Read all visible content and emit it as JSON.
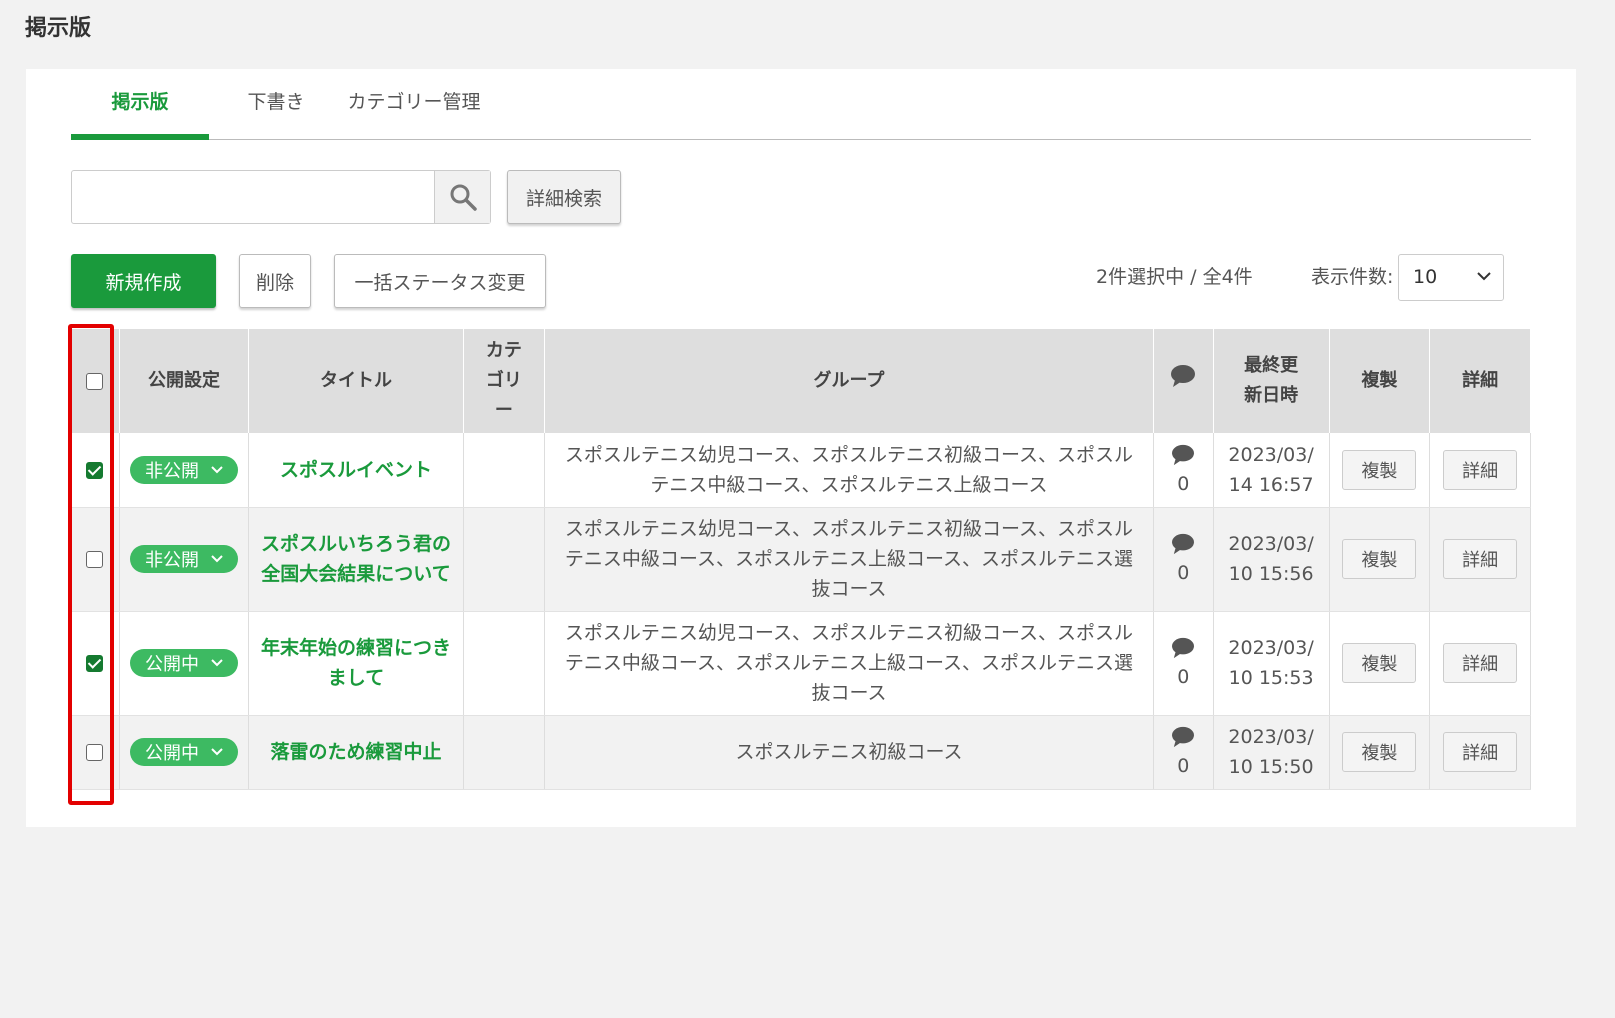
{
  "page": {
    "title": "掲示版"
  },
  "tabs": [
    {
      "label": "掲示版",
      "active": true
    },
    {
      "label": "下書き",
      "active": false
    },
    {
      "label": "カテゴリー管理",
      "active": false
    }
  ],
  "search": {
    "value": "",
    "placeholder": "",
    "icon": "search-icon",
    "advanced_label": "詳細検索"
  },
  "toolbar": {
    "create_label": "新規作成",
    "delete_label": "削除",
    "bulk_status_label": "一括ステータス変更",
    "selection_info": "2件選択中 / 全4件",
    "per_page_label": "表示件数:",
    "per_page_value": "10"
  },
  "table": {
    "headers": {
      "publish": "公開設定",
      "title": "タイトル",
      "category": "カテゴリー",
      "group": "グループ",
      "comment_icon": "comment-icon",
      "updated": "最終更新日時",
      "duplicate": "複製",
      "detail": "詳細"
    },
    "rows": [
      {
        "checked": true,
        "status": "非公開",
        "title": "スポスルイベント",
        "category": "",
        "group": "スポスルテニス幼児コース、スポスルテニス初級コース、スポスルテニス中級コース、スポスルテニス上級コース",
        "comments": "0",
        "updated_date": "2023/03/",
        "updated_time": "14 16:57",
        "duplicate": "複製",
        "detail": "詳細"
      },
      {
        "checked": false,
        "status": "非公開",
        "title": "スポスルいちろう君の全国大会結果について",
        "category": "",
        "group": "スポスルテニス幼児コース、スポスルテニス初級コース、スポスルテニス中級コース、スポスルテニス上級コース、スポスルテニス選抜コース",
        "comments": "0",
        "updated_date": "2023/03/",
        "updated_time": "10 15:56",
        "duplicate": "複製",
        "detail": "詳細"
      },
      {
        "checked": true,
        "status": "公開中",
        "title": "年末年始の練習につきまして",
        "category": "",
        "group": "スポスルテニス幼児コース、スポスルテニス初級コース、スポスルテニス中級コース、スポスルテニス上級コース、スポスルテニス選抜コース",
        "comments": "0",
        "updated_date": "2023/03/",
        "updated_time": "10 15:53",
        "duplicate": "複製",
        "detail": "詳細"
      },
      {
        "checked": false,
        "status": "公開中",
        "title": "落雷のため練習中止",
        "category": "",
        "group": "スポスルテニス初級コース",
        "comments": "0",
        "updated_date": "2023/03/",
        "updated_time": "10 15:50",
        "duplicate": "複製",
        "detail": "詳細"
      }
    ]
  },
  "colors": {
    "brand_green": "#1a9a3c",
    "status_pill": "#3dba62",
    "highlight_red": "#e30000",
    "header_bg": "#dedede"
  }
}
